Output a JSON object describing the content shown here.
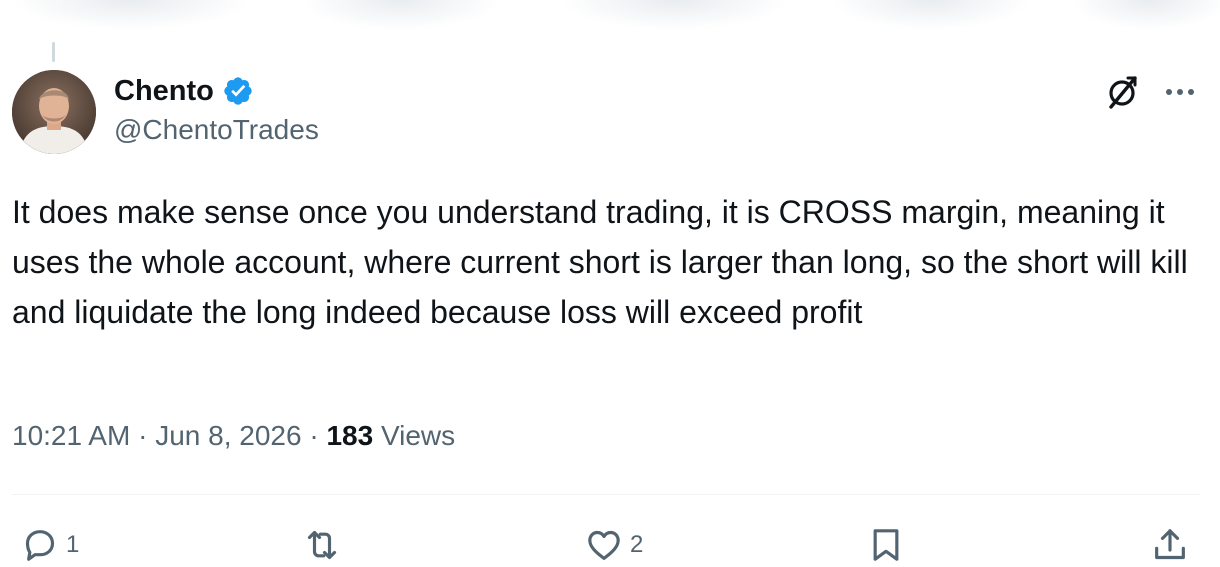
{
  "author": {
    "display_name": "Chento",
    "handle": "@ChentoTrades",
    "verified": true,
    "verified_color": "#1d9bf0"
  },
  "tweet": {
    "text": "It does make sense once you understand trading, it is CROSS margin, meaning it uses the whole account, where current short is larger than long, so the short will kill and liquidate the long indeed because loss will exceed profit",
    "time": "10:21 AM",
    "date": "Jun 8, 2026",
    "separator": "·",
    "views_count": "183",
    "views_label": "Views"
  },
  "actions": {
    "reply_count": "1",
    "repost_count": "",
    "like_count": "2"
  },
  "icons": {
    "grok": "grok-icon",
    "more": "more-icon",
    "reply": "reply-icon",
    "repost": "repost-icon",
    "like": "heart-icon",
    "bookmark": "bookmark-icon",
    "share": "share-icon"
  },
  "colors": {
    "text": "#0f1419",
    "secondary": "#536471",
    "divider": "#eff3f4"
  }
}
